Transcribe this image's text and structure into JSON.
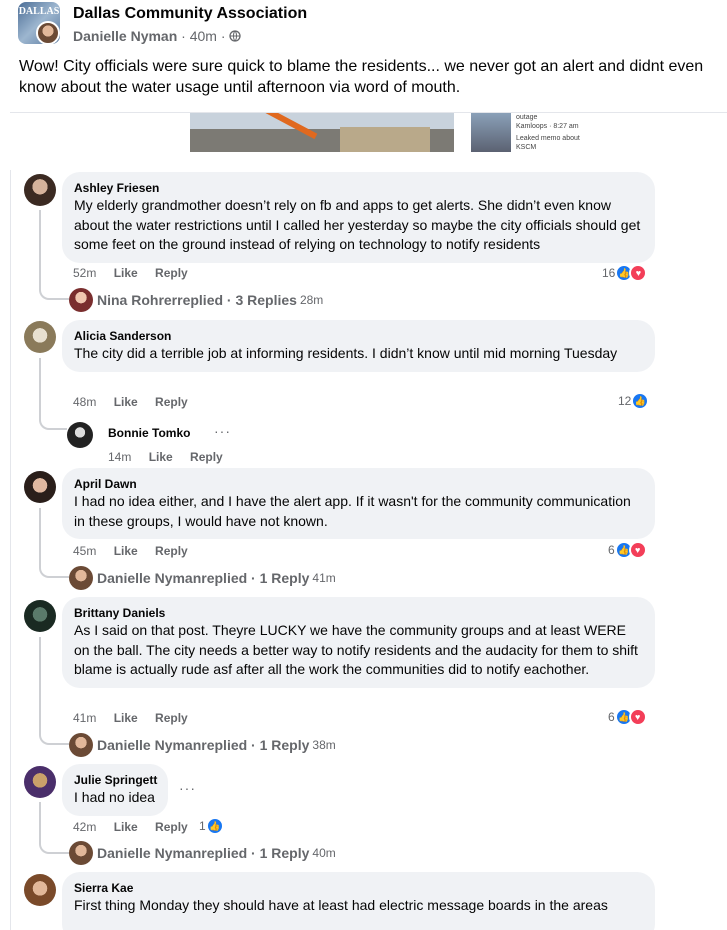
{
  "post": {
    "group_name": "Dallas Community Association",
    "group_avatar_text": "DALLAS",
    "author": "Danielle Nyman",
    "time": "40m",
    "privacy_icon": "globe-icon",
    "text": "Wow! City officials were sure quick to blame the residents... we never got an alert and didnt even know about the water usage until afternoon via word of mouth.",
    "preview": {
      "caption_line1": "outage",
      "caption_line2": "Kamloops · 8:27 am",
      "caption_line3": "Leaked memo about",
      "caption_line4": "KSCM"
    }
  },
  "comments": [
    {
      "name": "Ashley Friesen",
      "text": "My elderly grandmother doesn’t rely on fb and apps to get alerts. She didn’t even know about the water restrictions until I called her yesterday so maybe the city officials should get some feet on the ground instead of relying on technology to notify residents",
      "time": "52m",
      "like": "Like",
      "reply": "Reply",
      "reactions": "16",
      "replied": {
        "name": "Nina Rohrer",
        "text": " replied · 3 Replies",
        "time": "28m"
      }
    },
    {
      "name": "Alicia Sanderson",
      "text": "The city did a terrible job at informing residents. I didn’t know until mid morning Tuesday",
      "time": "48m",
      "like": "Like",
      "reply": "Reply",
      "reactions": "12",
      "nested": {
        "name": "Bonnie Tomko",
        "more": "···",
        "time": "14m",
        "like": "Like",
        "reply": "Reply"
      }
    },
    {
      "name": "April Dawn",
      "text": "I had no idea either, and I have the alert app. If it wasn't for the community communication in these groups, I would have not known.",
      "time": "45m",
      "like": "Like",
      "reply": "Reply",
      "reactions": "6",
      "replied": {
        "name": "Danielle Nyman",
        "text": " replied · 1 Reply",
        "time": "41m"
      }
    },
    {
      "name": "Brittany Daniels",
      "text": "As I said on that post. Theyre LUCKY we have the community groups and at least WERE on the ball. The city needs a better way to notify residents and the audacity for them to shift blame is actually rude asf after all the work the communities did to notify eachother.",
      "time": "41m",
      "like": "Like",
      "reply": "Reply",
      "reactions": "6",
      "replied": {
        "name": "Danielle Nyman",
        "text": " replied · 1 Reply",
        "time": "38m"
      }
    },
    {
      "name": "Julie Springett",
      "text": "I had no idea",
      "more": "···",
      "time": "42m",
      "like": "Like",
      "reply": "Reply",
      "reactions": "1",
      "replied": {
        "name": "Danielle Nyman",
        "text": " replied · 1 Reply",
        "time": "40m"
      }
    },
    {
      "name": "Sierra Kae",
      "text": "First thing Monday they should have at least had electric message boards in the areas"
    }
  ],
  "icons": {
    "like": "thumbs-up-icon",
    "love": "heart-icon",
    "more": "more-options-icon"
  },
  "colors": {
    "like": "#1877f2",
    "love": "#f33e58",
    "bubble": "#f0f2f5",
    "meta": "#65676b"
  }
}
